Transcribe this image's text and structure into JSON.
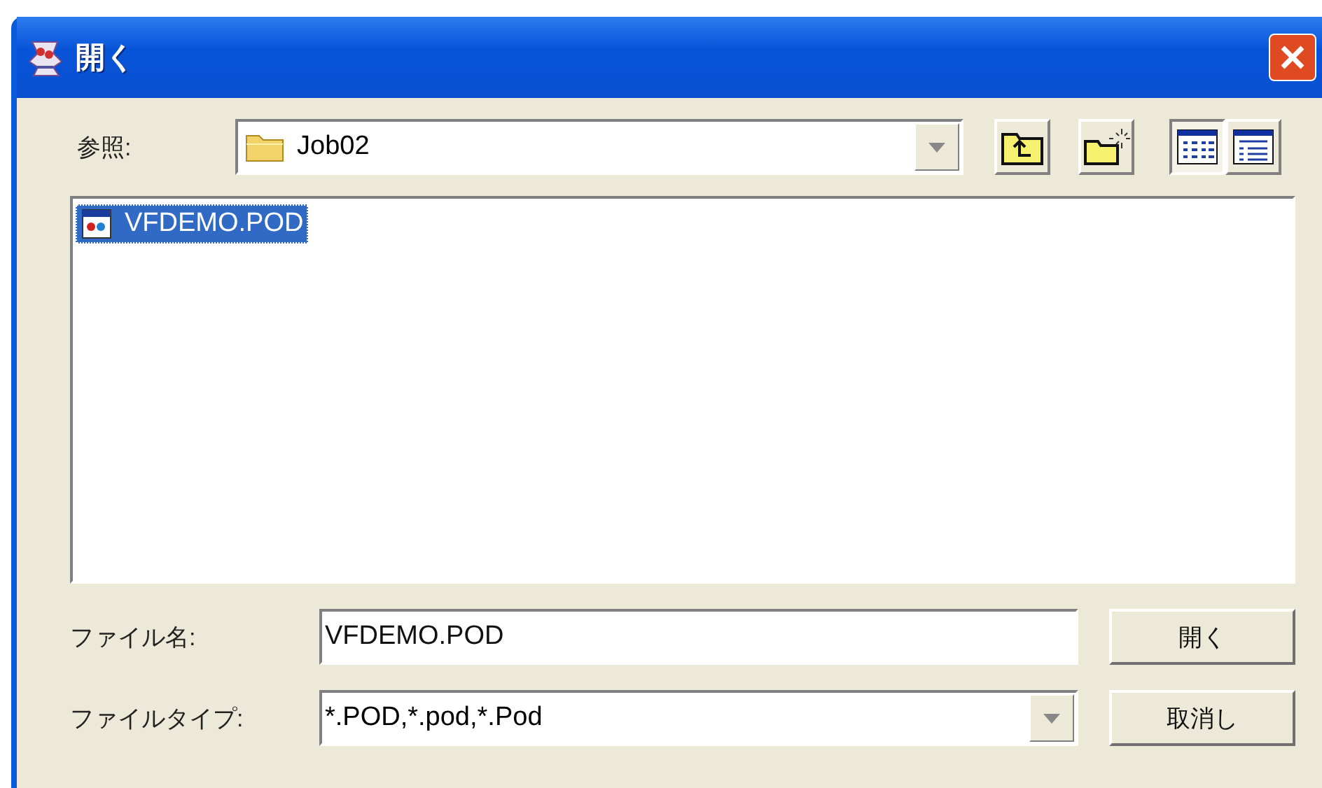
{
  "window": {
    "title": "開く"
  },
  "look_in": {
    "label": "参照:",
    "value": "Job02"
  },
  "view_buttons": [
    {
      "kind": "list",
      "selected": true
    },
    {
      "kind": "details",
      "selected": false
    }
  ],
  "files": [
    {
      "name": "VFDEMO.POD",
      "selected": true
    }
  ],
  "file_name": {
    "label": "ファイル名:",
    "value": "VFDEMO.POD"
  },
  "file_type": {
    "label": "ファイルタイプ:",
    "value": "*.POD,*.pod,*.Pod"
  },
  "buttons": [
    "開く",
    "取消し"
  ]
}
